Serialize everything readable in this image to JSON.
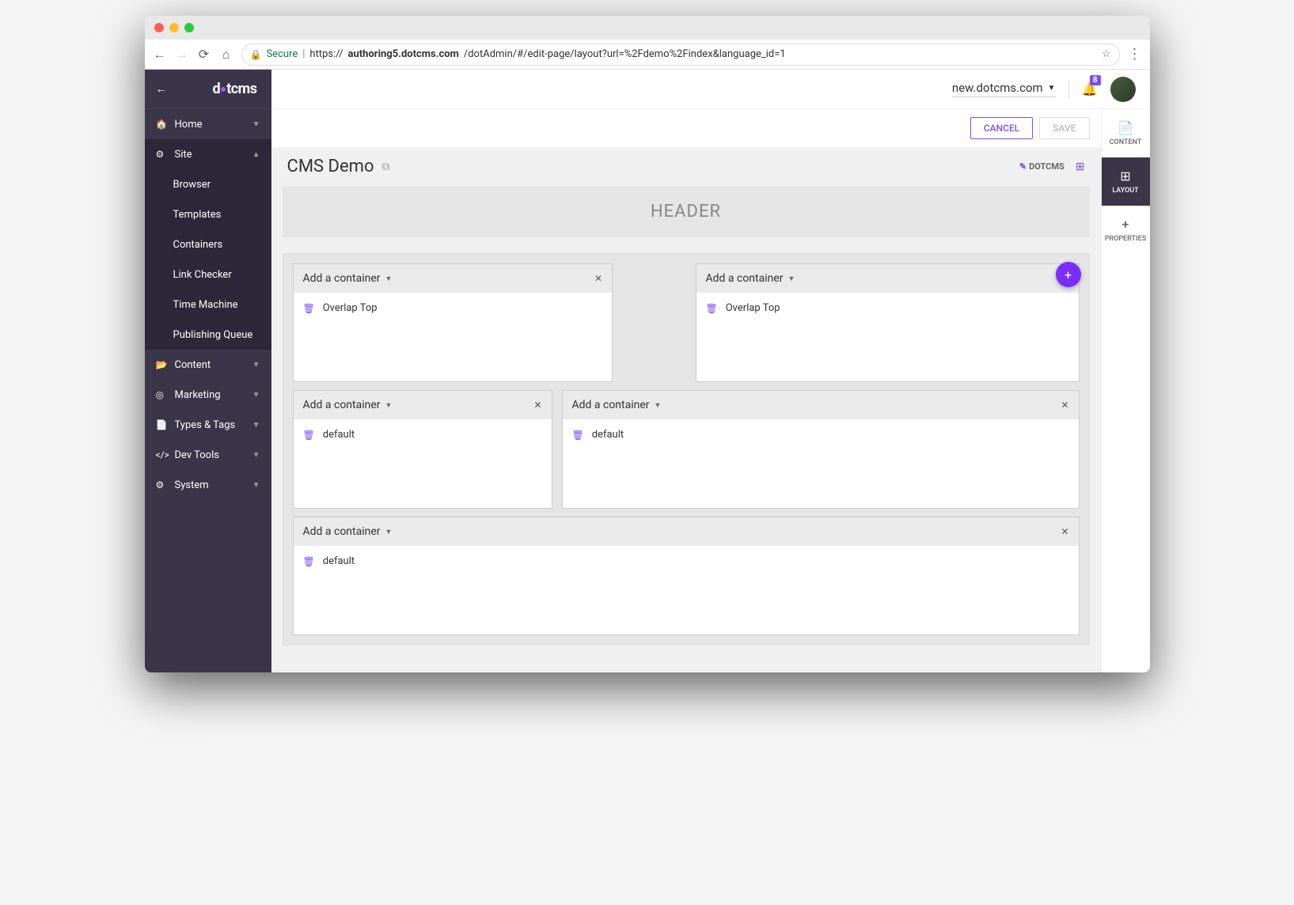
{
  "browser": {
    "url_secure": "Secure",
    "url_host": "authoring5.dotcms.com",
    "url_path": "/dotAdmin/#/edit-page/layout?url=%2Fdemo%2Findex&language_id=1",
    "url_prefix": "https://"
  },
  "logo": {
    "pre": "d",
    "mid": "t",
    "post": "cms"
  },
  "sidebar": {
    "items": [
      {
        "label": "Home",
        "icon": "🏠"
      },
      {
        "label": "Site",
        "icon": "⚙"
      },
      {
        "label": "Content",
        "icon": "📂"
      },
      {
        "label": "Marketing",
        "icon": "◎"
      },
      {
        "label": "Types & Tags",
        "icon": "📄"
      },
      {
        "label": "Dev Tools",
        "icon": "</>"
      },
      {
        "label": "System",
        "icon": "⚙"
      }
    ],
    "subitems": [
      "Browser",
      "Templates",
      "Containers",
      "Link Checker",
      "Time Machine",
      "Publishing Queue"
    ]
  },
  "header": {
    "domain": "new.dotcms.com",
    "notif_count": "8"
  },
  "actions": {
    "cancel": "CANCEL",
    "save": "SAVE"
  },
  "page": {
    "title": "CMS Demo",
    "theme_label": "DOTCMS",
    "header_label": "HEADER"
  },
  "boxes": {
    "add_container": "Add a container",
    "rows": [
      [
        {
          "width": "w5",
          "item": "Overlap Top"
        },
        {
          "spacer": true
        },
        {
          "width": "w6",
          "item": "Overlap Top"
        }
      ],
      [
        {
          "width": "w4",
          "item": "default"
        },
        {
          "width": "w8",
          "item": "default"
        }
      ],
      [
        {
          "width": "w12",
          "item": "default"
        }
      ]
    ]
  },
  "right_tabs": [
    {
      "label": "CONTENT",
      "icon": "📄"
    },
    {
      "label": "LAYOUT",
      "icon": "⊞"
    },
    {
      "label": "PROPERTIES",
      "icon": "+"
    }
  ]
}
